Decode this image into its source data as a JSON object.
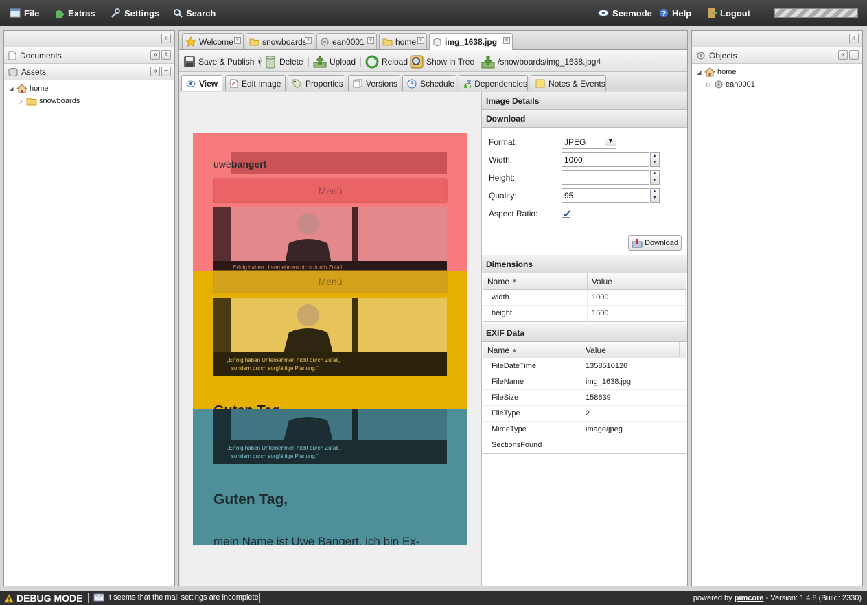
{
  "topbar": {
    "menus": [
      {
        "label": "File",
        "icon": "file-icon"
      },
      {
        "label": "Extras",
        "icon": "puzzle-icon"
      },
      {
        "label": "Settings",
        "icon": "wrench-icon"
      },
      {
        "label": "Search",
        "icon": "search-icon"
      }
    ],
    "right": [
      {
        "label": "Seemode",
        "icon": "eye-icon"
      },
      {
        "label": "Help",
        "icon": "help-icon"
      },
      {
        "label": "Logout",
        "icon": "logout-icon"
      }
    ]
  },
  "left": {
    "accordion": [
      {
        "label": "Documents"
      },
      {
        "label": "Assets"
      }
    ],
    "tree": [
      {
        "label": "home"
      },
      {
        "label": "snowboards"
      }
    ]
  },
  "right": {
    "accordion": [
      {
        "label": "Objects"
      }
    ],
    "tree": [
      {
        "label": "home"
      },
      {
        "label": "ean0001"
      }
    ]
  },
  "tabs": [
    {
      "label": "Welcome"
    },
    {
      "label": "snowboards"
    },
    {
      "label": "ean0001"
    },
    {
      "label": "home"
    },
    {
      "label": "img_1638.jpg"
    }
  ],
  "toolbar": {
    "save_publish": "Save & Publish",
    "delete": "Delete",
    "upload": "Upload",
    "reload": "Reload",
    "show_in_tree": "Show in Tree",
    "path": "/snowboards/img_1638.jpg",
    "id": "4"
  },
  "subtabs": [
    {
      "label": "View"
    },
    {
      "label": "Edit Image"
    },
    {
      "label": "Properties"
    },
    {
      "label": "Versions"
    },
    {
      "label": "Schedule"
    },
    {
      "label": "Dependencies"
    },
    {
      "label": "Notes & Events"
    }
  ],
  "preview": {
    "brand_light": "uwe",
    "brand_bold": "bangert",
    "menu": "Menü",
    "quote_short": "Erfolg haben Unternehmen nicht durch Zufall,",
    "quote_1": "„Erfolg haben Unternehmen nicht durch Zufall,",
    "quote_2": "sondern durch sorgfältige Planung.“",
    "heading_partial": "Guten Tag",
    "heading": "Guten Tag,",
    "body": "mein Name ist Uwe Bangert, ich bin Ex-",
    "colors": {
      "red": "#f77a7c",
      "yellow": "#e5b000",
      "teal": "#4e8f9a"
    }
  },
  "details": {
    "title": "Image Details",
    "download": {
      "title": "Download",
      "format_label": "Format:",
      "format_value": "JPEG",
      "width_label": "Width:",
      "width_value": "1000",
      "height_label": "Height:",
      "height_value": "",
      "quality_label": "Quality:",
      "quality_value": "95",
      "aspect_label": "Aspect Ratio:",
      "aspect_checked": true,
      "button": "Download"
    },
    "dimensions": {
      "title": "Dimensions",
      "col_name": "Name",
      "col_value": "Value",
      "rows": [
        {
          "name": "width",
          "value": "1000"
        },
        {
          "name": "height",
          "value": "1500"
        }
      ]
    },
    "exif": {
      "title": "EXIF Data",
      "col_name": "Name",
      "col_value": "Value",
      "rows": [
        {
          "name": "FileDateTime",
          "value": "1358510126"
        },
        {
          "name": "FileName",
          "value": "img_1638.jpg"
        },
        {
          "name": "FileSize",
          "value": "158639"
        },
        {
          "name": "FileType",
          "value": "2"
        },
        {
          "name": "MimeType",
          "value": "image/jpeg"
        },
        {
          "name": "SectionsFound",
          "value": ""
        }
      ]
    }
  },
  "status": {
    "debug": "DEBUG MODE",
    "message": "It seems that the mail settings are incomplete",
    "powered": "powered by",
    "brand": "pimcore",
    "version": "- Version: 1.4.8 (Build: 2330)"
  }
}
